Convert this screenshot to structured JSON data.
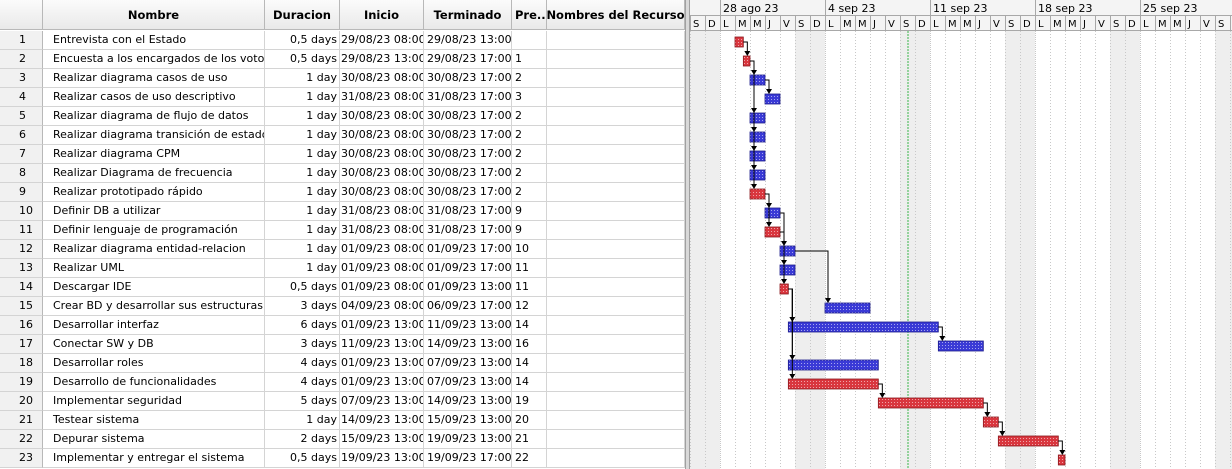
{
  "columns": {
    "id": "",
    "name": "Nombre",
    "duration": "Duracion",
    "start": "Inicio",
    "end": "Terminado",
    "pred": "Pre...",
    "resources": "Nombres del Recurso"
  },
  "tasks": [
    {
      "id": "1",
      "name": "Entrevista con el Estado",
      "duration": "0,5 days",
      "start": "29/08/23 08:00",
      "end": "29/08/23 13:00",
      "pred": "",
      "critical": true
    },
    {
      "id": "2",
      "name": "Encuesta a los encargados de los votos",
      "duration": "0,5 days",
      "start": "29/08/23 13:00",
      "end": "29/08/23 17:00",
      "pred": "1",
      "critical": true
    },
    {
      "id": "3",
      "name": "Realizar diagrama casos de uso",
      "duration": "1 day",
      "start": "30/08/23 08:00",
      "end": "30/08/23 17:00",
      "pred": "2",
      "critical": false
    },
    {
      "id": "4",
      "name": "Realizar casos de uso descriptivo",
      "duration": "1 day",
      "start": "31/08/23 08:00",
      "end": "31/08/23 17:00",
      "pred": "3",
      "critical": false
    },
    {
      "id": "5",
      "name": "Realizar diagrama de flujo de datos",
      "duration": "1 day",
      "start": "30/08/23 08:00",
      "end": "30/08/23 17:00",
      "pred": "2",
      "critical": false
    },
    {
      "id": "6",
      "name": "Realizar diagrama transición de estados",
      "duration": "1 day",
      "start": "30/08/23 08:00",
      "end": "30/08/23 17:00",
      "pred": "2",
      "critical": false
    },
    {
      "id": "7",
      "name": "Realizar diagrama CPM",
      "duration": "1 day",
      "start": "30/08/23 08:00",
      "end": "30/08/23 17:00",
      "pred": "2",
      "critical": false
    },
    {
      "id": "8",
      "name": "Realizar Diagrama de frecuencia",
      "duration": "1 day",
      "start": "30/08/23 08:00",
      "end": "30/08/23 17:00",
      "pred": "2",
      "critical": false
    },
    {
      "id": "9",
      "name": "Realizar prototipado rápido",
      "duration": "1 day",
      "start": "30/08/23 08:00",
      "end": "30/08/23 17:00",
      "pred": "2",
      "critical": true
    },
    {
      "id": "10",
      "name": "Definir DB a utilizar",
      "duration": "1 day",
      "start": "31/08/23 08:00",
      "end": "31/08/23 17:00",
      "pred": "9",
      "critical": false
    },
    {
      "id": "11",
      "name": "Definir lenguaje de programación",
      "duration": "1 day",
      "start": "31/08/23 08:00",
      "end": "31/08/23 17:00",
      "pred": "9",
      "critical": true
    },
    {
      "id": "12",
      "name": "Realizar diagrama entidad-relacion",
      "duration": "1 day",
      "start": "01/09/23 08:00",
      "end": "01/09/23 17:00",
      "pred": "10",
      "critical": false
    },
    {
      "id": "13",
      "name": "Realizar UML",
      "duration": "1 day",
      "start": "01/09/23 08:00",
      "end": "01/09/23 17:00",
      "pred": "11",
      "critical": false
    },
    {
      "id": "14",
      "name": "Descargar IDE",
      "duration": "0,5 days",
      "start": "01/09/23 08:00",
      "end": "01/09/23 13:00",
      "pred": "11",
      "critical": true
    },
    {
      "id": "15",
      "name": "Crear BD y desarrollar sus estructuras",
      "duration": "3 days",
      "start": "04/09/23 08:00",
      "end": "06/09/23 17:00",
      "pred": "12",
      "critical": false
    },
    {
      "id": "16",
      "name": "Desarrollar interfaz",
      "duration": "6 days",
      "start": "01/09/23 13:00",
      "end": "11/09/23 13:00",
      "pred": "14",
      "critical": false
    },
    {
      "id": "17",
      "name": "Conectar SW y DB",
      "duration": "3 days",
      "start": "11/09/23 13:00",
      "end": "14/09/23 13:00",
      "pred": "16",
      "critical": false
    },
    {
      "id": "18",
      "name": "Desarrollar roles",
      "duration": "4 days",
      "start": "01/09/23 13:00",
      "end": "07/09/23 13:00",
      "pred": "14",
      "critical": false
    },
    {
      "id": "19",
      "name": "Desarrollo de funcionalidades",
      "duration": "4 days",
      "start": "01/09/23 13:00",
      "end": "07/09/23 13:00",
      "pred": "14",
      "critical": true
    },
    {
      "id": "20",
      "name": "Implementar seguridad",
      "duration": "5 days",
      "start": "07/09/23 13:00",
      "end": "14/09/23 13:00",
      "pred": "19",
      "critical": true
    },
    {
      "id": "21",
      "name": "Testear sistema",
      "duration": "1 day",
      "start": "14/09/23 13:00",
      "end": "15/09/23 13:00",
      "pred": "20",
      "critical": true
    },
    {
      "id": "22",
      "name": "Depurar sistema",
      "duration": "2 days",
      "start": "15/09/23 13:00",
      "end": "19/09/23 13:00",
      "pred": "21",
      "critical": true
    },
    {
      "id": "23",
      "name": "Implementar y entregar el sistema",
      "duration": "0,5 days",
      "start": "19/09/23 13:00",
      "end": "19/09/23 17:00",
      "pred": "22",
      "critical": true
    }
  ],
  "gantt": {
    "weeks": [
      "28 ago 23",
      "4 sep 23",
      "11 sep 23",
      "18 sep 23",
      "25 sep 23"
    ],
    "day_letters": [
      "S",
      "D",
      "L",
      "M",
      "M",
      "J",
      "V",
      "S",
      "D",
      "L",
      "M",
      "M",
      "J",
      "V",
      "S",
      "D",
      "L",
      "M",
      "M",
      "J",
      "V",
      "S",
      "D",
      "L",
      "M",
      "M",
      "J",
      "V",
      "S",
      "D",
      "L",
      "M",
      "M",
      "J",
      "V",
      "S",
      "D",
      "L",
      "M",
      "M",
      "J",
      "V"
    ],
    "colors": {
      "critical": "#d9363e",
      "normal": "#3a3ad6",
      "today_line": "#39b54a"
    }
  }
}
